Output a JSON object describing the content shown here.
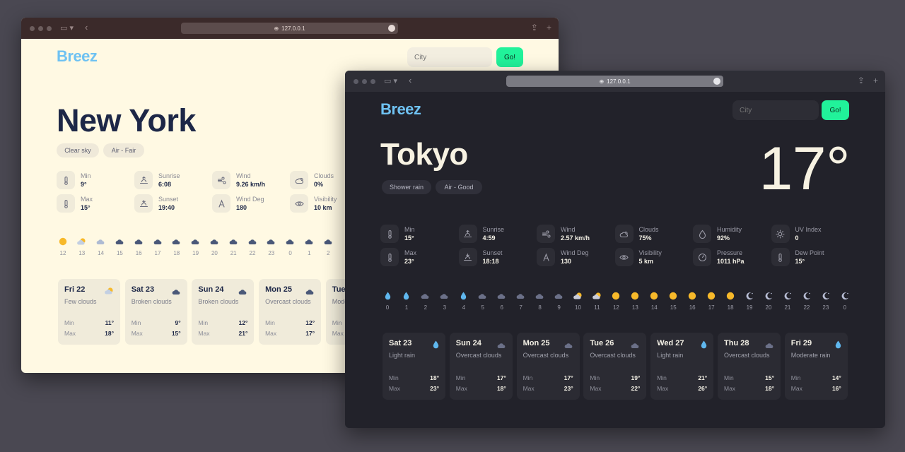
{
  "light": {
    "url": "127.0.0.1",
    "brand": "Breez",
    "search": {
      "placeholder": "City",
      "button": "Go!"
    },
    "city": "New York",
    "tags": [
      "Clear sky",
      "Air - Fair"
    ],
    "stats": [
      {
        "label": "Min",
        "value": "9°",
        "icon": "thermometer-icon"
      },
      {
        "label": "Max",
        "value": "15°",
        "icon": "thermometer-icon"
      },
      {
        "label": "Sunrise",
        "value": "6:08",
        "icon": "sunrise-icon"
      },
      {
        "label": "Sunset",
        "value": "19:40",
        "icon": "sunset-icon"
      },
      {
        "label": "Wind",
        "value": "9.26 km/h",
        "icon": "wind-icon"
      },
      {
        "label": "Wind Deg",
        "value": "180",
        "icon": "compass-icon"
      },
      {
        "label": "Clouds",
        "value": "0%",
        "icon": "cloud-icon"
      },
      {
        "label": "Visibility",
        "value": "10 km",
        "icon": "eye-icon"
      }
    ],
    "hourly": [
      {
        "h": "12",
        "icon": "sun"
      },
      {
        "h": "13",
        "icon": "partly"
      },
      {
        "h": "14",
        "icon": "cloud-light"
      },
      {
        "h": "15",
        "icon": "cloud"
      },
      {
        "h": "16",
        "icon": "cloud"
      },
      {
        "h": "17",
        "icon": "cloud"
      },
      {
        "h": "18",
        "icon": "cloud"
      },
      {
        "h": "19",
        "icon": "cloud"
      },
      {
        "h": "20",
        "icon": "cloud"
      },
      {
        "h": "21",
        "icon": "cloud"
      },
      {
        "h": "22",
        "icon": "cloud"
      },
      {
        "h": "23",
        "icon": "cloud"
      },
      {
        "h": "0",
        "icon": "cloud"
      },
      {
        "h": "1",
        "icon": "cloud"
      },
      {
        "h": "2",
        "icon": "cloud"
      }
    ],
    "days": [
      {
        "name": "Fri 22",
        "desc": "Few clouds",
        "min": "11°",
        "max": "18°",
        "icon": "partly"
      },
      {
        "name": "Sat 23",
        "desc": "Broken clouds",
        "min": "9°",
        "max": "15°",
        "icon": "cloud"
      },
      {
        "name": "Sun 24",
        "desc": "Broken clouds",
        "min": "12°",
        "max": "21°",
        "icon": "cloud"
      },
      {
        "name": "Mon 25",
        "desc": "Overcast clouds",
        "min": "12°",
        "max": "17°",
        "icon": "cloud"
      },
      {
        "name": "Tue",
        "desc": "Mode",
        "min": "",
        "max": "",
        "icon": ""
      }
    ],
    "min_label": "Min",
    "max_label": "Max"
  },
  "dark": {
    "url": "127.0.0.1",
    "brand": "Breez",
    "search": {
      "placeholder": "City",
      "button": "Go!"
    },
    "city": "Tokyo",
    "temp": "17°",
    "tags": [
      "Shower rain",
      "Air - Good"
    ],
    "stats": [
      {
        "label": "Min",
        "value": "15°",
        "icon": "thermometer-icon"
      },
      {
        "label": "Max",
        "value": "23°",
        "icon": "thermometer-icon"
      },
      {
        "label": "Sunrise",
        "value": "4:59",
        "icon": "sunrise-icon"
      },
      {
        "label": "Sunset",
        "value": "18:18",
        "icon": "sunset-icon"
      },
      {
        "label": "Wind",
        "value": "2.57 km/h",
        "icon": "wind-icon"
      },
      {
        "label": "Wind Deg",
        "value": "130",
        "icon": "compass-icon"
      },
      {
        "label": "Clouds",
        "value": "75%",
        "icon": "cloud-icon"
      },
      {
        "label": "Visibility",
        "value": "5 km",
        "icon": "eye-icon"
      },
      {
        "label": "Humidity",
        "value": "92%",
        "icon": "droplet-icon"
      },
      {
        "label": "Pressure",
        "value": "1011 hPa",
        "icon": "gauge-icon"
      },
      {
        "label": "UV Index",
        "value": "0",
        "icon": "sun-icon"
      },
      {
        "label": "Dew Point",
        "value": "15°",
        "icon": "thermometer-icon"
      }
    ],
    "hourly": [
      {
        "h": "0",
        "icon": "rain"
      },
      {
        "h": "1",
        "icon": "rain"
      },
      {
        "h": "2",
        "icon": "cloud"
      },
      {
        "h": "3",
        "icon": "cloud"
      },
      {
        "h": "4",
        "icon": "rain"
      },
      {
        "h": "5",
        "icon": "cloud"
      },
      {
        "h": "6",
        "icon": "cloud"
      },
      {
        "h": "7",
        "icon": "cloud"
      },
      {
        "h": "8",
        "icon": "cloud"
      },
      {
        "h": "9",
        "icon": "cloud"
      },
      {
        "h": "10",
        "icon": "partly"
      },
      {
        "h": "11",
        "icon": "partly"
      },
      {
        "h": "12",
        "icon": "sun"
      },
      {
        "h": "13",
        "icon": "sun"
      },
      {
        "h": "14",
        "icon": "sun"
      },
      {
        "h": "15",
        "icon": "sun"
      },
      {
        "h": "16",
        "icon": "sun"
      },
      {
        "h": "17",
        "icon": "sun"
      },
      {
        "h": "18",
        "icon": "sun"
      },
      {
        "h": "19",
        "icon": "moon"
      },
      {
        "h": "20",
        "icon": "moon"
      },
      {
        "h": "21",
        "icon": "moon"
      },
      {
        "h": "22",
        "icon": "moon"
      },
      {
        "h": "23",
        "icon": "moon"
      },
      {
        "h": "0",
        "icon": "moon"
      }
    ],
    "days": [
      {
        "name": "Sat 23",
        "desc": "Light rain",
        "min": "18°",
        "max": "23°",
        "icon": "rain"
      },
      {
        "name": "Sun 24",
        "desc": "Overcast clouds",
        "min": "17°",
        "max": "18°",
        "icon": "cloud"
      },
      {
        "name": "Mon 25",
        "desc": "Overcast clouds",
        "min": "17°",
        "max": "23°",
        "icon": "cloud"
      },
      {
        "name": "Tue 26",
        "desc": "Overcast clouds",
        "min": "19°",
        "max": "22°",
        "icon": "cloud"
      },
      {
        "name": "Wed 27",
        "desc": "Light rain",
        "min": "21°",
        "max": "26°",
        "icon": "rain"
      },
      {
        "name": "Thu 28",
        "desc": "Overcast clouds",
        "min": "15°",
        "max": "18°",
        "icon": "cloud"
      },
      {
        "name": "Fri 29",
        "desc": "Moderate rain",
        "min": "14°",
        "max": "16°",
        "icon": "rain"
      }
    ],
    "min_label": "Min",
    "max_label": "Max"
  },
  "colors": {
    "brand": "#6fc2f2",
    "go": "#21f29a",
    "light_bg": "#fff9e3",
    "dark_bg": "#22222a",
    "sun": "#f7b92a",
    "rain": "#5fb7ee",
    "cloud_dark": "#4a5878",
    "cloud_night": "#6b7088",
    "moon": "#b9bfd6"
  }
}
